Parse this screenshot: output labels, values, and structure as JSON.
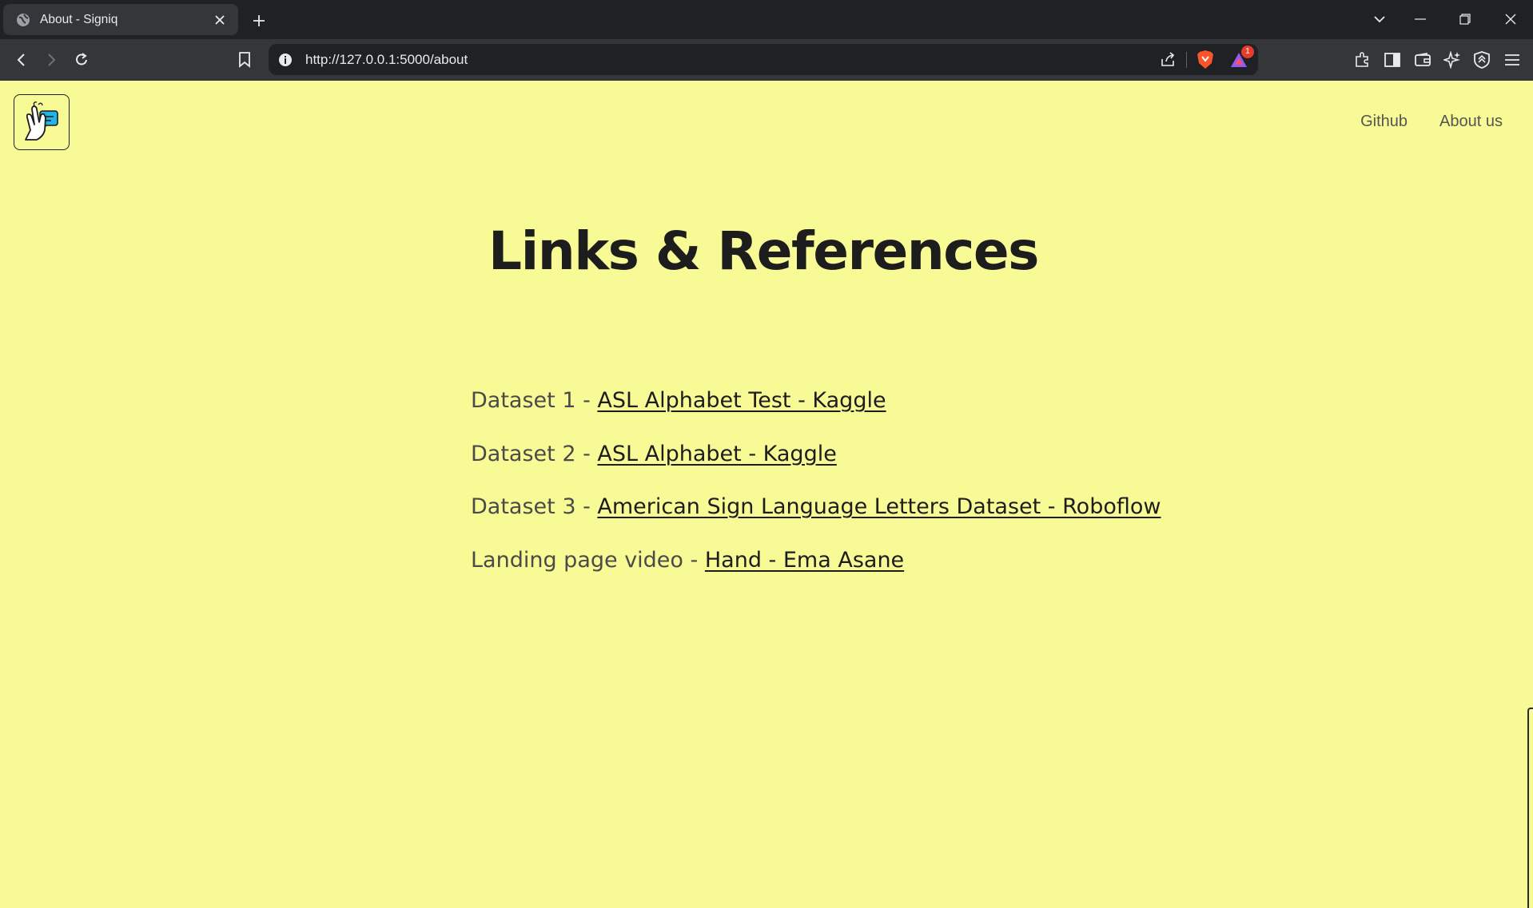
{
  "browser": {
    "tab": {
      "title": "About - Signiq",
      "favicon": "globe-icon"
    },
    "url": "http://127.0.0.1:5000/about",
    "shields_badge_count": "1"
  },
  "site": {
    "logo": "hand-sign-logo",
    "nav": [
      {
        "label": "Github"
      },
      {
        "label": "About us"
      }
    ]
  },
  "main": {
    "heading": "Links & References",
    "references": [
      {
        "prefix": "Dataset 1 - ",
        "link": "ASL Alphabet Test - Kaggle"
      },
      {
        "prefix": "Dataset 2 - ",
        "link": "ASL Alphabet - Kaggle"
      },
      {
        "prefix": "Dataset 3 - ",
        "link": "American Sign Language Letters Dataset - Roboflow"
      },
      {
        "prefix": "Landing page video - ",
        "link": "Hand - Ema Asane"
      }
    ]
  },
  "colors": {
    "page_background": "#f8fa95",
    "heading_text": "#1d1d1d",
    "body_text": "#4a4a48",
    "browser_frame": "#202124",
    "browser_toolbar": "#35363a"
  }
}
